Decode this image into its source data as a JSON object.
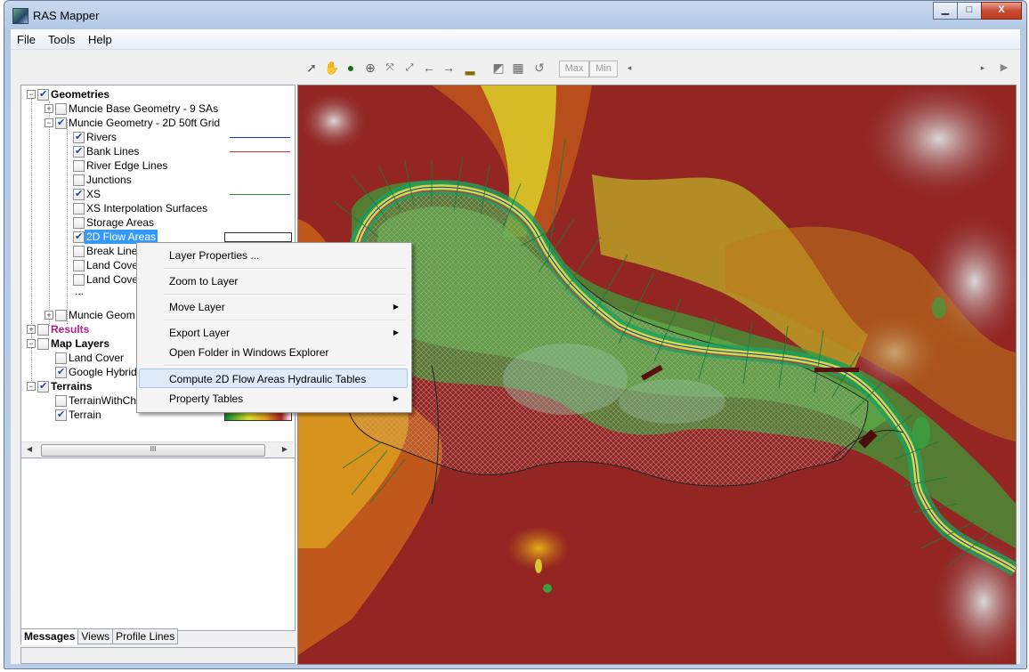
{
  "window": {
    "title": "RAS Mapper",
    "buttons": [
      "minimize",
      "maximize",
      "close"
    ],
    "close_glyph": "X"
  },
  "menu": [
    "File",
    "Tools",
    "Help"
  ],
  "toolbar": {
    "tools": [
      "select-arrow-icon",
      "pan-hand-icon",
      "globe-icon",
      "zoom-in-icon",
      "zoom-extents-icon",
      "zoom-full-icon",
      "back-arrow-icon",
      "forward-arrow-icon",
      "measure-icon",
      "profile-icon",
      "raster-icon",
      "link-icon"
    ],
    "max_label": "Max",
    "min_label": "Min"
  },
  "tree": {
    "geometries": "Geometries",
    "geom1": "Muncie Base Geometry - 9 SAs",
    "geom2": "Muncie Geometry - 2D 50ft Grid",
    "rivers": "Rivers",
    "bank_lines": "Bank Lines",
    "river_edge_lines": "River Edge Lines",
    "junctions": "Junctions",
    "xs": "XS",
    "xs_interp": "XS Interpolation Surfaces",
    "storage_areas": "Storage Areas",
    "flow_areas": "2D Flow Areas",
    "break_lines": "Break Lines",
    "land_cover1": "Land Cover",
    "land_cover2": "Land Cover",
    "ellipsis": "...",
    "geom3": "Muncie Geom",
    "results": "Results",
    "map_layers": "Map Layers",
    "ml_land_cover": "Land Cover",
    "google_hybrid": "Google Hybrid",
    "terrains": "Terrains",
    "terrain_with": "TerrainWithCh",
    "terrain": "Terrain",
    "colors": {
      "rivers": "#1c2fb8",
      "bank_lines": "#e0283a",
      "xs": "#2a8a3a"
    }
  },
  "scroll_thumb_glyph": "III",
  "tabs": [
    "Messages",
    "Views",
    "Profile Lines"
  ],
  "context_menu": {
    "items": [
      {
        "label": "Layer Properties ...",
        "submenu": false
      },
      {
        "label": "Zoom to Layer",
        "submenu": false
      },
      {
        "label": "Move Layer",
        "submenu": true
      },
      {
        "label": "Export Layer",
        "submenu": true
      },
      {
        "label": "Open Folder in Windows Explorer",
        "submenu": false
      },
      {
        "label": "Compute 2D Flow Areas Hydraulic Tables",
        "submenu": false
      },
      {
        "label": "Property Tables",
        "submenu": true
      }
    ],
    "highlighted": "Compute 2D Flow Areas Hydraulic Tables"
  }
}
